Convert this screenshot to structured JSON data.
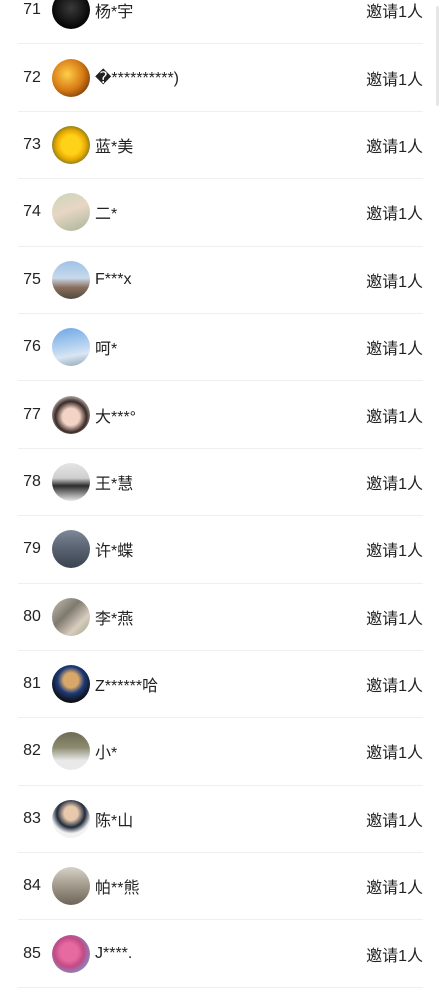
{
  "invite_list": {
    "rows": [
      {
        "rank": "71",
        "name": "杨*宇",
        "invite": "邀请1人",
        "avatar": "av-black"
      },
      {
        "rank": "72",
        "name": "�**********)",
        "invite": "邀请1人",
        "avatar": "av-sunset"
      },
      {
        "rank": "73",
        "name": "蓝*美",
        "invite": "邀请1人",
        "avatar": "av-flower"
      },
      {
        "rank": "74",
        "name": "二*",
        "invite": "邀请1人",
        "avatar": "av-girl1"
      },
      {
        "rank": "75",
        "name": "F***x",
        "invite": "邀请1人",
        "avatar": "av-street"
      },
      {
        "rank": "76",
        "name": "呵*",
        "invite": "邀请1人",
        "avatar": "av-sky"
      },
      {
        "rank": "77",
        "name": "大***°",
        "invite": "邀请1人",
        "avatar": "av-girl2"
      },
      {
        "rank": "78",
        "name": "王*慧",
        "invite": "邀请1人",
        "avatar": "av-girl3"
      },
      {
        "rank": "79",
        "name": "许*蝶",
        "invite": "邀请1人",
        "avatar": "av-crowd"
      },
      {
        "rank": "80",
        "name": "李*燕",
        "invite": "邀请1人",
        "avatar": "av-couple"
      },
      {
        "rank": "81",
        "name": "Z******哈",
        "invite": "邀请1人",
        "avatar": "av-pearl"
      },
      {
        "rank": "82",
        "name": "小*",
        "invite": "邀请1人",
        "avatar": "av-tree"
      },
      {
        "rank": "83",
        "name": "陈*山",
        "invite": "邀请1人",
        "avatar": "av-man"
      },
      {
        "rank": "84",
        "name": "帕**熊",
        "invite": "邀请1人",
        "avatar": "av-house"
      },
      {
        "rank": "85",
        "name": "J****.",
        "invite": "邀请1人",
        "avatar": "av-pink"
      }
    ]
  }
}
